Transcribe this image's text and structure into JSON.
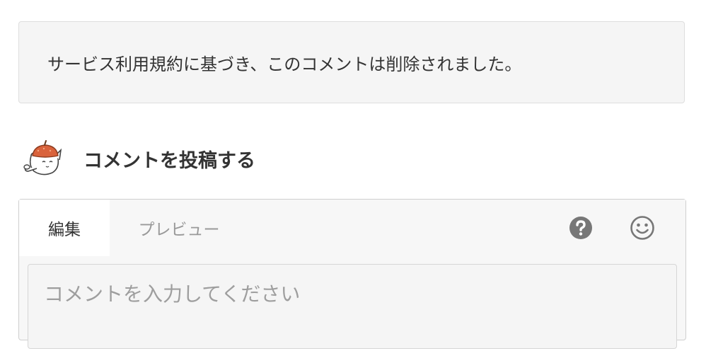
{
  "deleted_notice": {
    "text": "サービス利用規約に基づき、このコメントは削除されました。"
  },
  "post_comment": {
    "heading": "コメントを投稿する",
    "mascot_icon": "acorn-cat-mascot-icon"
  },
  "editor": {
    "tabs": [
      {
        "label": "編集",
        "active": true
      },
      {
        "label": "プレビュー",
        "active": false
      }
    ],
    "help_icon": "question-circle-icon",
    "emoji_icon": "smiley-icon",
    "input_placeholder": "コメントを入力してください",
    "input_value": ""
  },
  "colors": {
    "notice_bg": "#f5f5f5",
    "text": "#333333",
    "muted_text": "#999999",
    "icon_gray": "#777777",
    "acorn_cap": "#d9623b"
  }
}
